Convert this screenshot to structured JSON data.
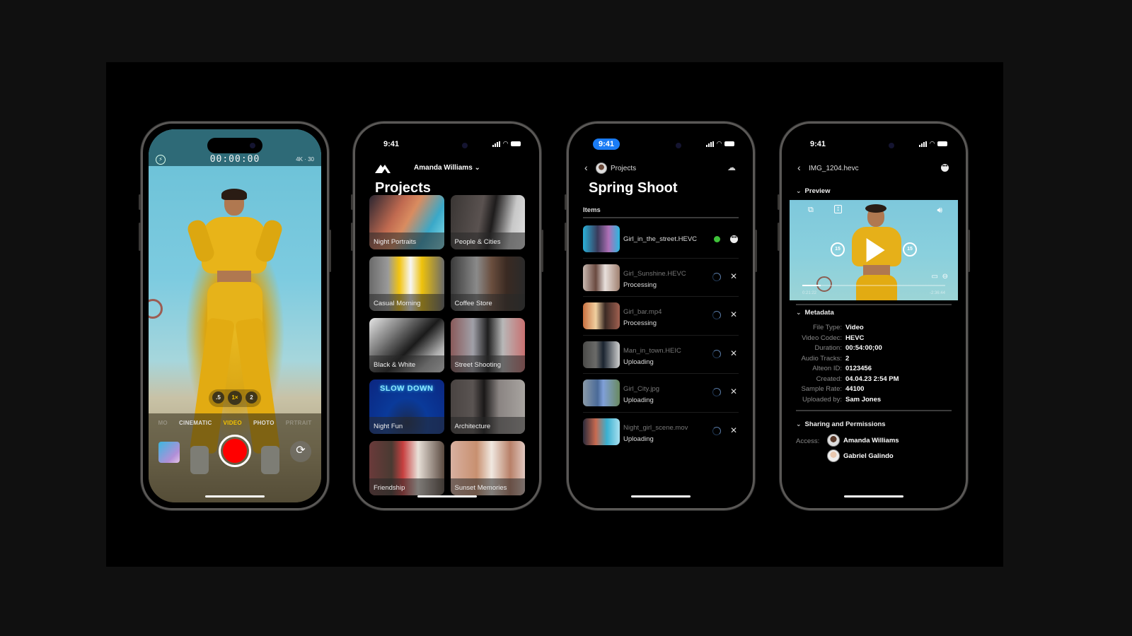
{
  "phones": {
    "camera": {
      "timer": "00:00:00",
      "resolution": "4K · 30",
      "zoom_levels": [
        ".5",
        "1×",
        "2"
      ],
      "zoom_selected": "1×",
      "modes": [
        "CINEMATIC",
        "VIDEO",
        "PHOTO",
        "PRTRAIT"
      ],
      "mode_selected": "VIDEO",
      "icons": {
        "flash": "flash-icon",
        "flip": "camera-flip-icon"
      },
      "colors": {
        "record": "#ff0000",
        "active_mode": "#f5c400"
      }
    },
    "projects": {
      "status_time": "9:41",
      "account_name": "Amanda Williams",
      "title": "Projects",
      "tiles": [
        {
          "label": "Night Portraits"
        },
        {
          "label": "People & Cities"
        },
        {
          "label": "Casual Morning"
        },
        {
          "label": "Coffee Store"
        },
        {
          "label": "Black & White"
        },
        {
          "label": "Street Shooting"
        },
        {
          "label": "Night Fun"
        },
        {
          "label": "Architecture"
        },
        {
          "label": "Friendship"
        },
        {
          "label": "Sunset Memories"
        }
      ],
      "night_fun_sign": "SLOW DOWN"
    },
    "spring_shoot": {
      "status_time": "9:41",
      "back_label": "Projects",
      "title": "Spring Shoot",
      "section": "Items",
      "items": [
        {
          "name": "Girl_in_the_street.HEVC",
          "status": "",
          "state": "ready"
        },
        {
          "name": "Girl_Sunshine.HEVC",
          "status": "Processing",
          "state": "busy"
        },
        {
          "name": "Girl_bar.mp4",
          "status": "Processing",
          "state": "busy"
        },
        {
          "name": "Man_in_town.HEIC",
          "status": "Uploading",
          "state": "busy"
        },
        {
          "name": "Girl_City.jpg",
          "status": "Uploading",
          "state": "busy"
        },
        {
          "name": "Night_girl_scene.mov",
          "status": "Uploading",
          "state": "busy"
        }
      ],
      "colors": {
        "ready_dot": "#3fc23a",
        "time_pill": "#1a7cf5"
      }
    },
    "file_detail": {
      "status_time": "9:41",
      "back_label": "IMG_1204.hevc",
      "preview_label": "Preview",
      "video": {
        "elapsed": "0:21:22",
        "remaining": "-2:36:44",
        "progress": 0.13,
        "skip_back": "15",
        "skip_forward": "15"
      },
      "metadata_label": "Metadata",
      "metadata": [
        {
          "key": "File Type:",
          "value": "Video"
        },
        {
          "key": "Video Codec:",
          "value": "HEVC"
        },
        {
          "key": "Duration:",
          "value": "00:54:00;00"
        },
        {
          "key": "Audio Tracks:",
          "value": "2"
        },
        {
          "key": "Alteon ID:",
          "value": "0123456"
        },
        {
          "key": "Created:",
          "value": "04.04.23 2:54 PM"
        },
        {
          "key": "Sample Rate:",
          "value": "44100"
        },
        {
          "key": "Uploaded by:",
          "value": "Sam Jones"
        }
      ],
      "sharing_label": "Sharing and Permissions",
      "access_label": "Access:",
      "users": [
        "Amanda Williams",
        "Gabriel Galindo"
      ]
    }
  }
}
